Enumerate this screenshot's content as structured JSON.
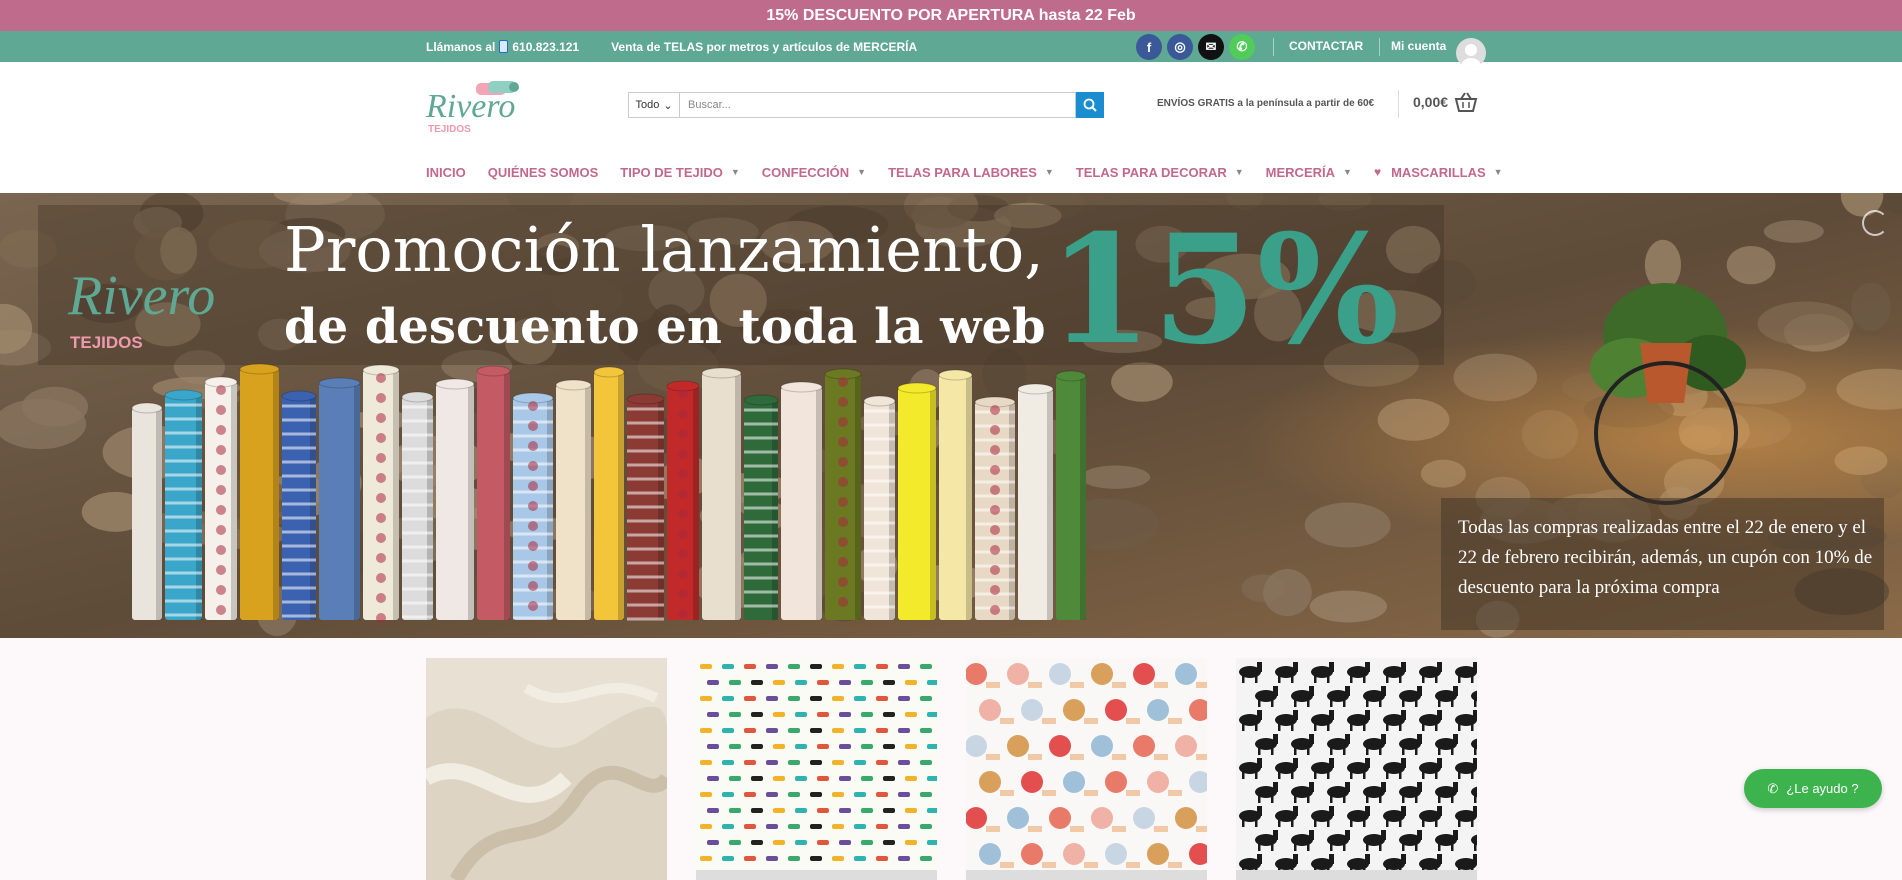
{
  "promo_bar": {
    "text": "15% DESCUENTO POR APERTURA hasta 22 Feb"
  },
  "topbar": {
    "call_label": "Llámanos al",
    "phone": "610.823.121",
    "tagline": "Venta de TELAS por metros y artículos de MERCERÍA",
    "contact_label": "CONTACTAR",
    "account_label": "Mi cuenta",
    "social": [
      {
        "icon": "facebook-icon",
        "glyph": "f",
        "color": "#3b5998"
      },
      {
        "icon": "instagram-icon",
        "glyph": "◎",
        "color": "#3b5998"
      },
      {
        "icon": "email-icon",
        "glyph": "✉",
        "color": "#111111"
      },
      {
        "icon": "phone-icon",
        "glyph": "✆",
        "color": "#51cb5a"
      }
    ]
  },
  "header": {
    "logo_text": "Rivero",
    "logo_sub": "TEJIDOS",
    "search": {
      "category": "Todo",
      "placeholder": "Buscar..."
    },
    "shipping": "ENVÍOS GRATIS a la península a partir de 60€",
    "cart_total": "0,00€"
  },
  "nav": {
    "items": [
      {
        "label": "INICIO",
        "dropdown": false
      },
      {
        "label": "QUIÉNES SOMOS",
        "dropdown": false
      },
      {
        "label": "TIPO DE TEJIDO",
        "dropdown": true
      },
      {
        "label": "CONFECCIÓN",
        "dropdown": true
      },
      {
        "label": "TELAS PARA LABORES",
        "dropdown": true
      },
      {
        "label": "TELAS PARA DECORAR",
        "dropdown": true
      },
      {
        "label": "MERCERÍA",
        "dropdown": true
      },
      {
        "label": "MASCARILLAS",
        "dropdown": true,
        "icon": "heart-icon"
      }
    ]
  },
  "hero": {
    "title_line1": "Promoción lanzamiento,",
    "title_line2": "de descuento en toda la web",
    "percent": "15%",
    "logo_text": "Rivero",
    "logo_sub": "TEJIDOS",
    "note": "Todas las compras realizadas entre el 22 de enero y el 22 de febrero recibirán, además, un cupón con 10% de descuento para la próxima compra"
  },
  "products": [
    {
      "name": "cream-fabric-image"
    },
    {
      "name": "sewing-pattern-fabric-image"
    },
    {
      "name": "sewing-notions-fabric-image"
    },
    {
      "name": "horse-pattern-fabric-image"
    }
  ],
  "help_button": {
    "label": "¿Le ayudo ?"
  },
  "colors": {
    "accent_pink": "#be6b8c",
    "accent_green": "#5fa893",
    "search_blue": "#1a8dd0",
    "whatsapp_green": "#3db34d"
  }
}
